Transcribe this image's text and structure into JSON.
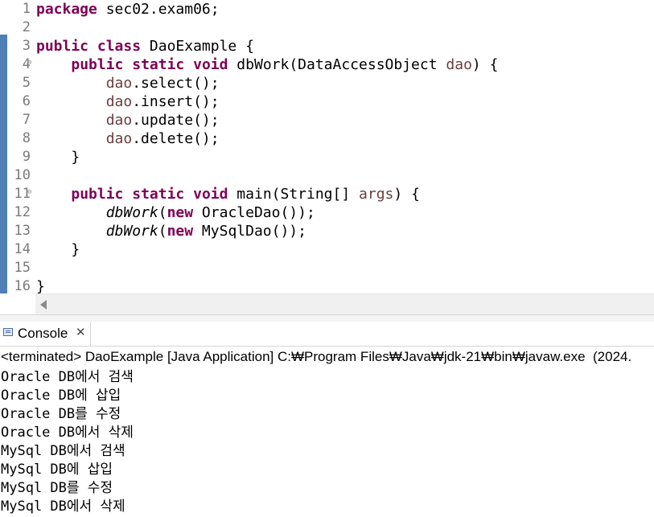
{
  "editor": {
    "lines": [
      {
        "n": "1",
        "fold": "",
        "parts": [
          {
            "t": "package",
            "c": "kw"
          },
          {
            "t": " sec02.exam06;",
            "c": ""
          }
        ]
      },
      {
        "n": "2",
        "fold": "",
        "parts": []
      },
      {
        "n": "3",
        "fold": "",
        "parts": [
          {
            "t": "public",
            "c": "kw"
          },
          {
            "t": " ",
            "c": ""
          },
          {
            "t": "class",
            "c": "kw"
          },
          {
            "t": " DaoExample {",
            "c": ""
          }
        ]
      },
      {
        "n": "4",
        "fold": "⊖",
        "parts": [
          {
            "t": "    ",
            "c": ""
          },
          {
            "t": "public",
            "c": "kw"
          },
          {
            "t": " ",
            "c": ""
          },
          {
            "t": "static",
            "c": "kw"
          },
          {
            "t": " ",
            "c": ""
          },
          {
            "t": "void",
            "c": "kw"
          },
          {
            "t": " dbWork(DataAccessObject ",
            "c": ""
          },
          {
            "t": "dao",
            "c": "fld"
          },
          {
            "t": ") {",
            "c": ""
          }
        ]
      },
      {
        "n": "5",
        "fold": "",
        "parts": [
          {
            "t": "        ",
            "c": ""
          },
          {
            "t": "dao",
            "c": "fld"
          },
          {
            "t": ".select();",
            "c": ""
          }
        ]
      },
      {
        "n": "6",
        "fold": "",
        "parts": [
          {
            "t": "        ",
            "c": ""
          },
          {
            "t": "dao",
            "c": "fld"
          },
          {
            "t": ".insert();",
            "c": ""
          }
        ]
      },
      {
        "n": "7",
        "fold": "",
        "parts": [
          {
            "t": "        ",
            "c": ""
          },
          {
            "t": "dao",
            "c": "fld"
          },
          {
            "t": ".update();",
            "c": ""
          }
        ]
      },
      {
        "n": "8",
        "fold": "",
        "parts": [
          {
            "t": "        ",
            "c": ""
          },
          {
            "t": "dao",
            "c": "fld"
          },
          {
            "t": ".delete();",
            "c": ""
          }
        ]
      },
      {
        "n": "9",
        "fold": "",
        "parts": [
          {
            "t": "    }",
            "c": ""
          }
        ]
      },
      {
        "n": "10",
        "fold": "",
        "parts": []
      },
      {
        "n": "11",
        "fold": "⊖",
        "parts": [
          {
            "t": "    ",
            "c": ""
          },
          {
            "t": "public",
            "c": "kw"
          },
          {
            "t": " ",
            "c": ""
          },
          {
            "t": "static",
            "c": "kw"
          },
          {
            "t": " ",
            "c": ""
          },
          {
            "t": "void",
            "c": "kw"
          },
          {
            "t": " main(String[] ",
            "c": ""
          },
          {
            "t": "args",
            "c": "fld"
          },
          {
            "t": ") {",
            "c": ""
          }
        ]
      },
      {
        "n": "12",
        "fold": "",
        "parts": [
          {
            "t": "        ",
            "c": ""
          },
          {
            "t": "dbWork",
            "c": "it"
          },
          {
            "t": "(",
            "c": ""
          },
          {
            "t": "new",
            "c": "kw"
          },
          {
            "t": " OracleDao());",
            "c": ""
          }
        ]
      },
      {
        "n": "13",
        "fold": "",
        "parts": [
          {
            "t": "        ",
            "c": ""
          },
          {
            "t": "dbWork",
            "c": "it"
          },
          {
            "t": "(",
            "c": ""
          },
          {
            "t": "new",
            "c": "kw"
          },
          {
            "t": " MySqlDao());",
            "c": ""
          }
        ]
      },
      {
        "n": "14",
        "fold": "",
        "parts": [
          {
            "t": "    }",
            "c": ""
          }
        ]
      },
      {
        "n": "15",
        "fold": "",
        "parts": []
      },
      {
        "n": "16",
        "fold": "",
        "parts": [
          {
            "t": "}",
            "c": ""
          }
        ]
      }
    ]
  },
  "console": {
    "tab_label": "Console",
    "close_glyph": "✕",
    "status": "<terminated> DaoExample [Java Application] C:₩Program Files₩Java₩jdk-21₩bin₩javaw.exe  (2024.",
    "output": [
      "Oracle DB에서 검색",
      "Oracle DB에 삽입",
      "Oracle DB를 수정",
      "Oracle DB에서 삭제",
      "MySql DB에서 검색",
      "MySql DB에 삽입",
      "MySql DB를 수정",
      "MySql DB에서 삭제"
    ]
  },
  "colors": {
    "keyword": "#7f0055",
    "field": "#6a3e3e",
    "change_bar": "#4f7fb7"
  }
}
